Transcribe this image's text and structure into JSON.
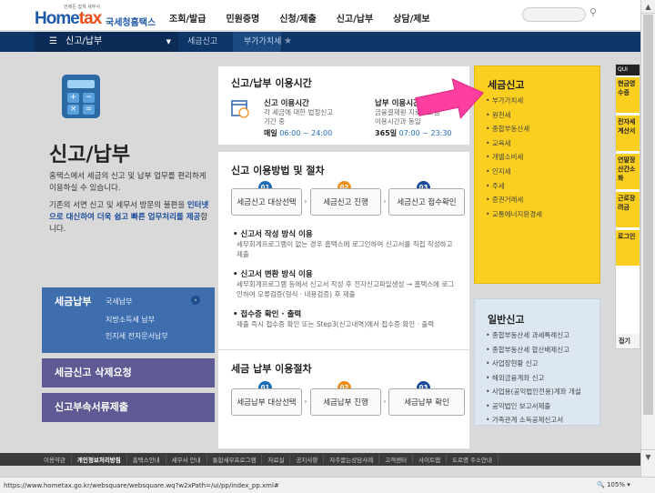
{
  "header": {
    "logo_tagline": "언제든 쉽게 세무서",
    "logo_en_pre": "Home",
    "logo_en_post": "tax",
    "logo_kr": "국세청홈택스",
    "menu": [
      "조회/발급",
      "민원증명",
      "신청/제출",
      "신고/납부",
      "상담/제보"
    ]
  },
  "subnav": {
    "current": "신고/납부",
    "crumbs": [
      "세금신고",
      "부가가치세"
    ]
  },
  "left": {
    "title": "신고/납부",
    "desc1": "홈택스에서 세금의 신고 및 납부 업무를 편리하게 이용하실 수 있습니다.",
    "desc2_a": "기존의 서면 신고 및 세무서 방문의 불편을 ",
    "desc2_b": "인터넷으로 대신하여 더욱 쉽고 빠른 업무처리를 제공",
    "desc2_c": "합니다.",
    "nav1_title": "세금납부",
    "nav1_subs": [
      "국세납부",
      "지방소득세 납부",
      "인지세 전자문서납부"
    ],
    "nav2": "세금신고 삭제요청",
    "nav3": "신고부속서류제출"
  },
  "hours": {
    "title": "신고/납부 이용시간",
    "a_title": "신고 이용시간",
    "a_desc": "각 세금에 대한 법정신고 기간 중",
    "a_day": "매일",
    "a_time": "06:00 ~ 24:00",
    "b_title": "납부 이용시간",
    "b_desc": "금융결제원 지로시스템 이용시간과 동일",
    "b_day": "365일",
    "b_time": "07:00 ~ 23:30"
  },
  "method": {
    "title": "신고 이용방법 및 절차",
    "steps": [
      {
        "num": "01",
        "label": "세금신고 대상선택"
      },
      {
        "num": "02",
        "label": "세금신고 진행"
      },
      {
        "num": "03",
        "label": "세금신고 접수확인"
      }
    ],
    "s1_title": "신고서 작성 방식 이용",
    "s1_desc": "세무회계프로그램이 없는 경우 홈택스에 로그인하여 신고서를 직접 작성하고 제출",
    "s2_title": "신고서 변환 방식 이용",
    "s2_desc": "세무회계프로그램 등에서 신고서 작성 후 전자신고파일생성 → 홈택스에 로그인하여 오류검증(형식 · 내용검증) 후 제출",
    "s3_title": "접수증 확인 · 출력",
    "s3_desc": "제출 즉시 접수증 확인 또는 Step3(신고내역)에서 접수증 확인 · 출력"
  },
  "payment": {
    "title": "세금 납부 이용절차",
    "steps": [
      {
        "num": "01",
        "label": "세금납부 대상선택"
      },
      {
        "num": "02",
        "label": "세금납부 진행"
      },
      {
        "num": "03",
        "label": "세금납부 확인"
      }
    ]
  },
  "tax_panel": {
    "title": "세금신고",
    "items": [
      "부가가치세",
      "원천세",
      "종합부동산세",
      "교육세",
      "개별소비세",
      "인지세",
      "주세",
      "증권거래세",
      "교통에너지환경세"
    ]
  },
  "general_panel": {
    "title": "일반신고",
    "items": [
      "종합부동산세 과세특례신고",
      "종합부동산세 합산배제신고",
      "사업장현황 신고",
      "해외금융계좌 신고",
      "사업용(공익법인전용)계좌 개설",
      "공익법인 보고서제출",
      "가족관계 소득공제신고서"
    ]
  },
  "quick": {
    "head": "QUI",
    "items": [
      "현금영수증",
      "전자세계산서",
      "연말정산간소화",
      "근로장려금",
      "로그인"
    ],
    "bottom": "접기"
  },
  "footer": [
    "이용약관",
    "개인정보처리방침",
    "홈택스안내",
    "세무서 안내",
    "통합세무프로그램",
    "자료실",
    "공지사항",
    "자주묻는상담사례",
    "고객센터",
    "사이트맵",
    "도로명 주소안내"
  ],
  "status": {
    "url": "https://www.hometax.go.kr/websquare/websquare.wq?w2xPath=/ui/pp/index_pp.xml#",
    "zoom": "105%"
  },
  "colors": {
    "brand_blue": "#1e5aa8",
    "nav_dark": "#0d3567",
    "tax_yellow": "#fbcf1f",
    "arrow_pink": "#ff3fa0"
  }
}
